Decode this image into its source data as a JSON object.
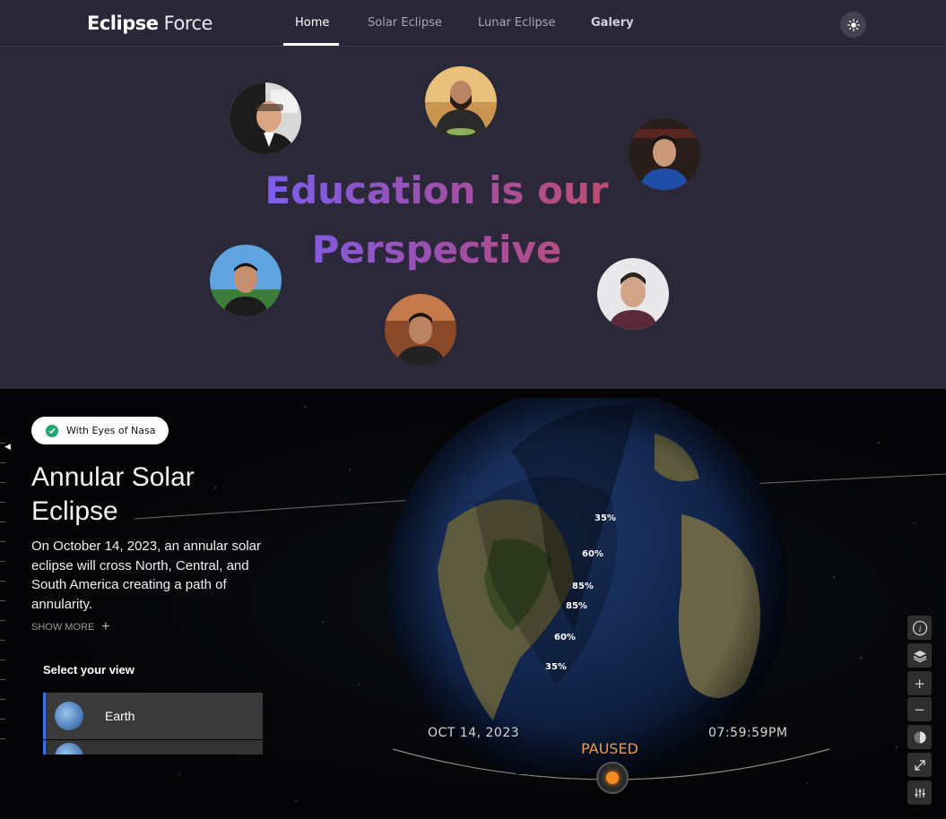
{
  "nav": {
    "logo_bold": "Eclipse",
    "logo_light": "Force",
    "items": [
      {
        "label": "Home"
      },
      {
        "label": "Solar Eclipse"
      },
      {
        "label": "Lunar Eclipse"
      },
      {
        "label": "Galery"
      }
    ],
    "active": "Home"
  },
  "hero": {
    "headline_line1": "Education is our",
    "headline_line2": "Perspective",
    "team_avatars": [
      "team-member-1",
      "team-member-2",
      "team-member-3",
      "team-member-4",
      "team-member-5",
      "team-member-6"
    ]
  },
  "eyes": {
    "badge": "With Eyes of Nasa",
    "title_line1": "Annular Solar",
    "title_line2": "Eclipse",
    "description": "On October 14, 2023, an annular solar eclipse will cross North, Central, and South America creating a path of annularity.",
    "show_more": "SHOW MORE",
    "select_view": "Select your view",
    "views": [
      {
        "label": "Earth"
      }
    ],
    "contours": [
      "35%",
      "60%",
      "85%",
      "85%",
      "60%",
      "35%"
    ],
    "date": "OCT 14, 2023",
    "time": "07:59:59PM",
    "status": "PAUSED"
  },
  "colors": {
    "accent_orange": "#f58a1f",
    "view_highlight": "#3e6fe0",
    "badge_check": "#1ea672"
  },
  "icons": [
    "sun-icon",
    "check-icon",
    "plus-icon",
    "globe-icon",
    "info-icon",
    "layers-icon",
    "zoom-in-icon",
    "zoom-out-icon",
    "lighting-icon",
    "expand-icon",
    "settings-icon"
  ]
}
